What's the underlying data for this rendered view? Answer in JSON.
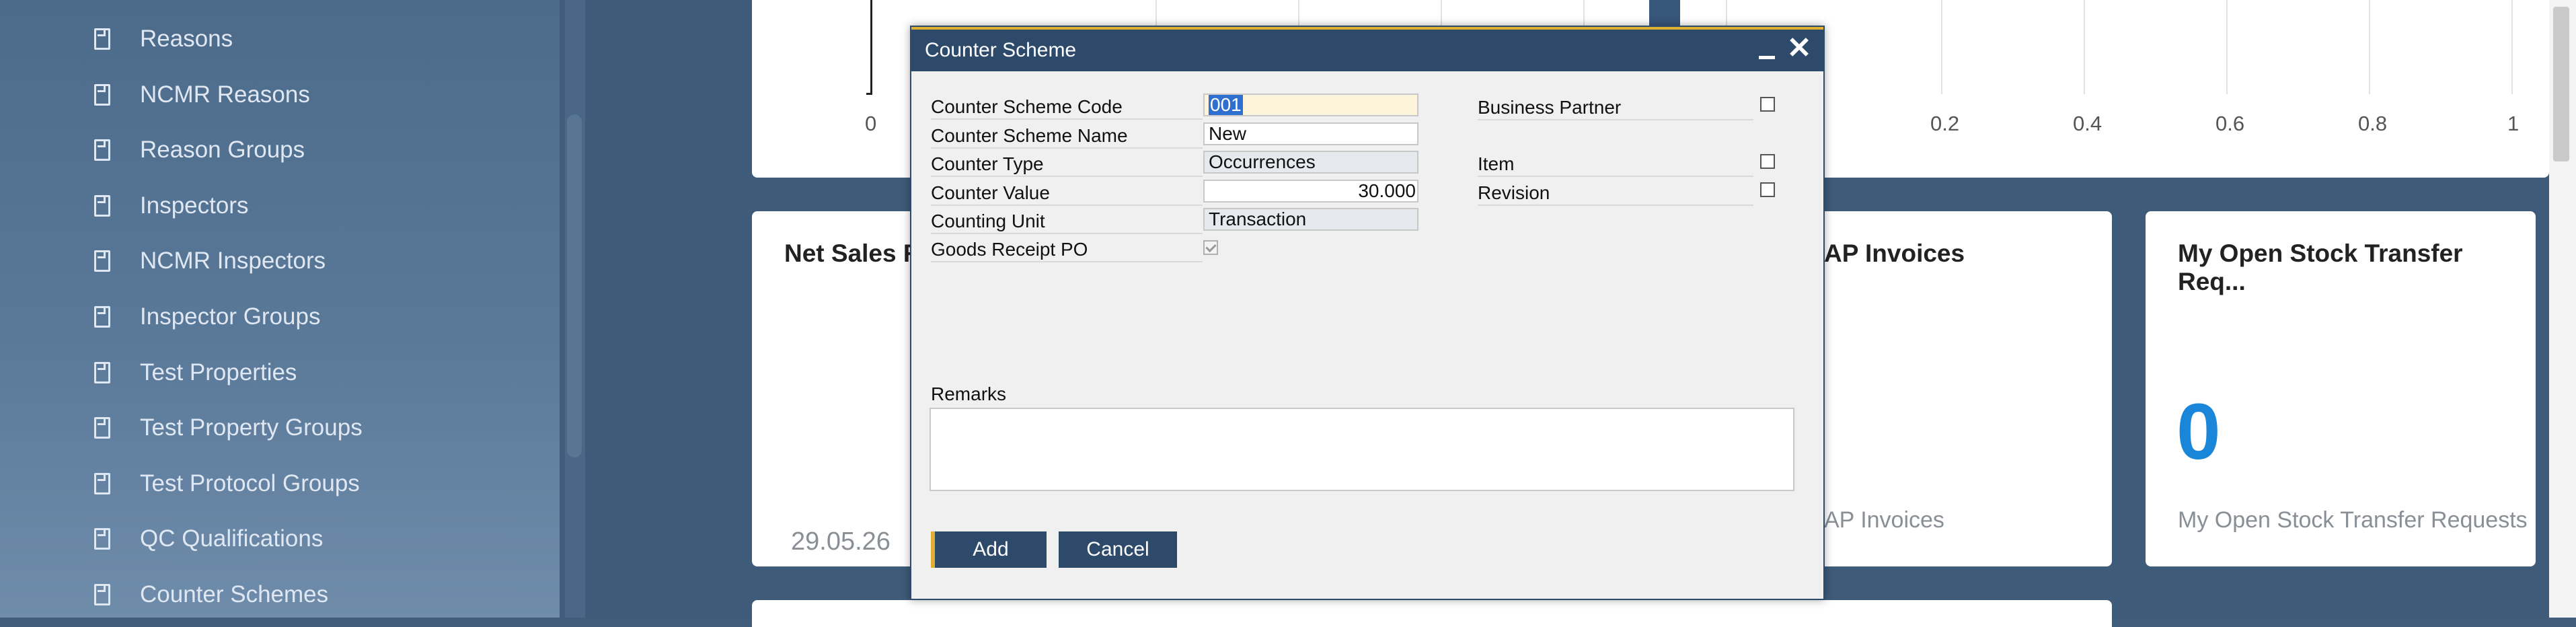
{
  "sidebar": {
    "items": [
      {
        "label": "Reasons"
      },
      {
        "label": "NCMR Reasons"
      },
      {
        "label": "Reason Groups"
      },
      {
        "label": "Inspectors"
      },
      {
        "label": "NCMR Inspectors"
      },
      {
        "label": "Inspector Groups"
      },
      {
        "label": "Test Properties"
      },
      {
        "label": "Test Property Groups"
      },
      {
        "label": "Test Protocol Groups"
      },
      {
        "label": "QC Qualifications"
      },
      {
        "label": "Counter Schemes"
      }
    ]
  },
  "dashboard": {
    "chart_axis": {
      "ticks": [
        "0",
        "0.2",
        "0.4",
        "0.6",
        "0.8",
        "1"
      ]
    },
    "net_sales": {
      "title": "Net Sales R",
      "date": "29.05.26"
    },
    "ap_invoices": {
      "title": "AP Invoices",
      "subtitle": "AP Invoices"
    },
    "stock_transfer": {
      "title": "My Open Stock Transfer Req...",
      "value": "0",
      "subtitle": "My Open Stock Transfer Requests"
    }
  },
  "modal": {
    "title": "Counter Scheme",
    "fields": {
      "code": {
        "label": "Counter Scheme Code",
        "value": "001"
      },
      "name": {
        "label": "Counter Scheme Name",
        "value": "New"
      },
      "type": {
        "label": "Counter Type",
        "value": "Occurrences"
      },
      "counter_value": {
        "label": "Counter Value",
        "value": "30.000"
      },
      "unit": {
        "label": "Counting Unit",
        "value": "Transaction"
      },
      "grpo": {
        "label": "Goods Receipt PO",
        "checked": true
      }
    },
    "checks": {
      "business_partner": {
        "label": "Business Partner",
        "checked": false
      },
      "item": {
        "label": "Item",
        "checked": false
      },
      "revision": {
        "label": "Revision",
        "checked": false
      }
    },
    "remarks_label": "Remarks",
    "add_label": "Add",
    "cancel_label": "Cancel"
  },
  "colors": {
    "accent": "#e0b030",
    "header": "#2d4a6b",
    "kpi_blue": "#1a86d9"
  }
}
